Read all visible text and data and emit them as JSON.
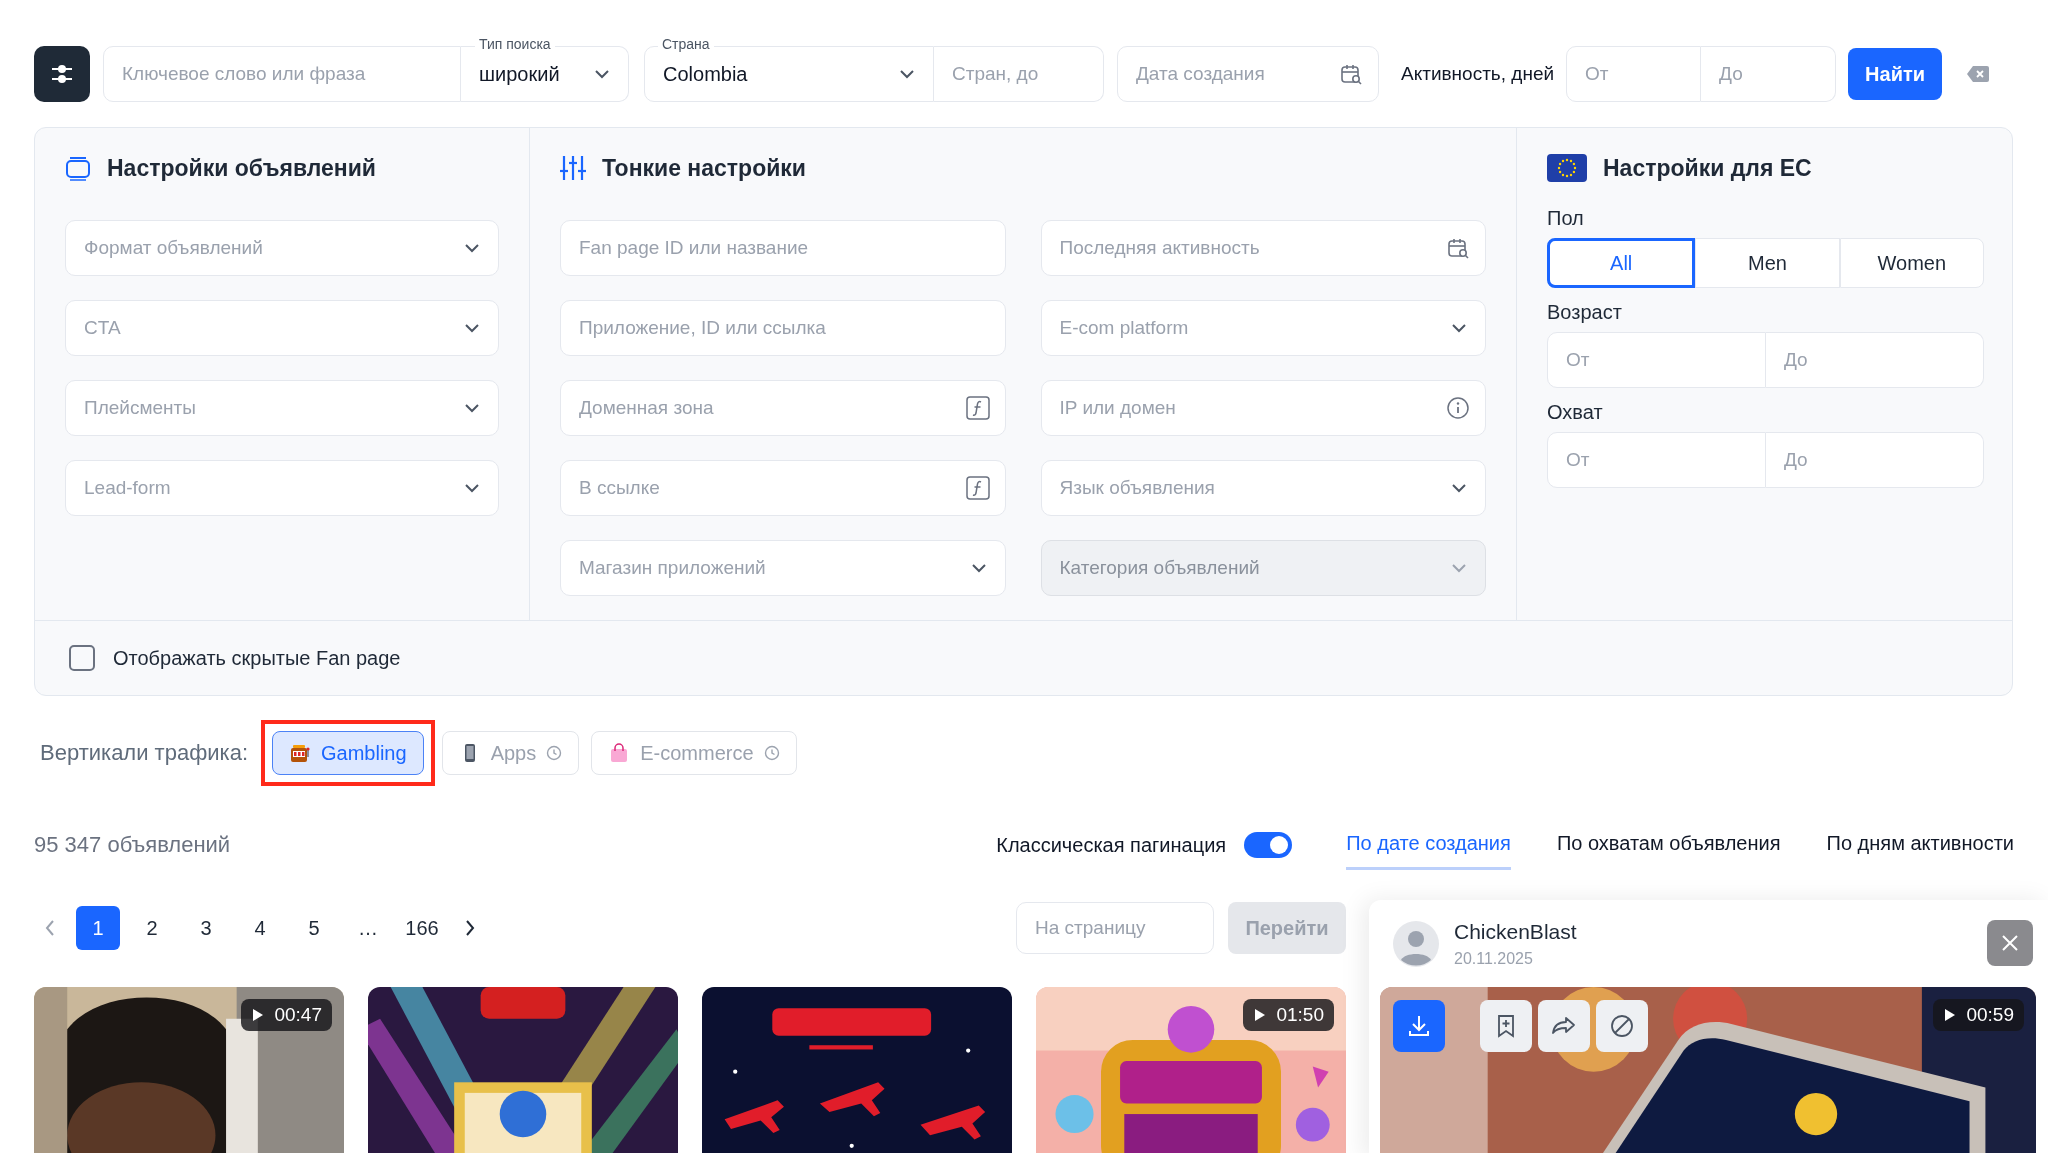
{
  "search_bar": {
    "keyword": {
      "placeholder": "Ключевое слово или фраза"
    },
    "search_type": {
      "label": "Тип поиска",
      "value": "широкий"
    },
    "country": {
      "label": "Страна",
      "value": "Colombia"
    },
    "country_exclude": {
      "placeholder": "Стран, до"
    },
    "created_date": {
      "placeholder": "Дата создания"
    },
    "activity": {
      "label": "Активность, дней",
      "from_placeholder": "От",
      "to_placeholder": "До"
    },
    "find_button": "Найти"
  },
  "filters": {
    "ad_settings": {
      "title": "Настройки объявлений",
      "fields": [
        {
          "kind": "select",
          "placeholder": "Формат объявлений",
          "disabled": false
        },
        {
          "kind": "select",
          "placeholder": "CTA",
          "disabled": false
        },
        {
          "kind": "select",
          "placeholder": "Плейсменты",
          "disabled": false
        },
        {
          "kind": "select",
          "placeholder": "Lead-form",
          "disabled": false
        }
      ]
    },
    "fine_settings": {
      "title": "Тонкие настройки",
      "fields": [
        {
          "kind": "input",
          "placeholder": "Fan page ID или название",
          "disabled": false
        },
        {
          "kind": "date",
          "placeholder": "Последняя активность",
          "disabled": false
        },
        {
          "kind": "input",
          "placeholder": "Приложение, ID или ссылка",
          "disabled": false
        },
        {
          "kind": "select",
          "placeholder": "E-com platform",
          "disabled": false
        },
        {
          "kind": "formula",
          "placeholder": "Доменная зона",
          "disabled": false
        },
        {
          "kind": "info",
          "placeholder": "IP или домен",
          "disabled": false
        },
        {
          "kind": "formula",
          "placeholder": "В ссылке",
          "disabled": false
        },
        {
          "kind": "select",
          "placeholder": "Язык объявления",
          "disabled": false
        },
        {
          "kind": "select",
          "placeholder": "Магазин приложений",
          "disabled": false
        },
        {
          "kind": "select",
          "placeholder": "Категория объявлений",
          "disabled": true
        }
      ]
    },
    "eu_settings": {
      "title": "Настройки для ЕС",
      "gender_label": "Пол",
      "genders": [
        {
          "label": "All",
          "selected": true
        },
        {
          "label": "Men",
          "selected": false
        },
        {
          "label": "Women",
          "selected": false
        }
      ],
      "age_label": "Возраст",
      "age": {
        "from_placeholder": "От",
        "to_placeholder": "До"
      },
      "reach_label": "Охват",
      "reach": {
        "from_placeholder": "От",
        "to_placeholder": "До"
      }
    },
    "show_hidden": {
      "label": "Отображать скрытые Fan page",
      "checked": false
    }
  },
  "verticals": {
    "label": "Вертикали трафика:",
    "items": [
      {
        "label": "Gambling",
        "selected": true,
        "locked": false,
        "highlighted": true
      },
      {
        "label": "Apps",
        "selected": false,
        "locked": true,
        "highlighted": false
      },
      {
        "label": "E-commerce",
        "selected": false,
        "locked": true,
        "highlighted": false
      }
    ]
  },
  "results": {
    "count": "95 347 объявлений",
    "pagination_toggle": {
      "label": "Классическая пагинация",
      "on": true
    },
    "sort_tabs": [
      {
        "label": "По дате создания",
        "selected": true
      },
      {
        "label": "По охватам объявления",
        "selected": false
      },
      {
        "label": "По дням активности",
        "selected": false
      }
    ]
  },
  "pagination": {
    "pages": [
      {
        "label": "1",
        "selected": true
      },
      {
        "label": "2",
        "selected": false
      },
      {
        "label": "3",
        "selected": false
      },
      {
        "label": "4",
        "selected": false
      },
      {
        "label": "5",
        "selected": false
      },
      {
        "label": "…",
        "selected": false
      },
      {
        "label": "166",
        "selected": false
      }
    ],
    "goto": {
      "placeholder": "На страницу",
      "button": "Перейти",
      "disabled": true
    }
  },
  "cards": [
    {
      "kind": "picture",
      "duration": "00:47"
    },
    {
      "kind": "picture"
    },
    {
      "kind": "picture"
    },
    {
      "kind": "picture",
      "duration": "01:50"
    }
  ],
  "detail": {
    "name": "ChickenBlast",
    "date": "20.11.2025",
    "duration": "00:59"
  }
}
